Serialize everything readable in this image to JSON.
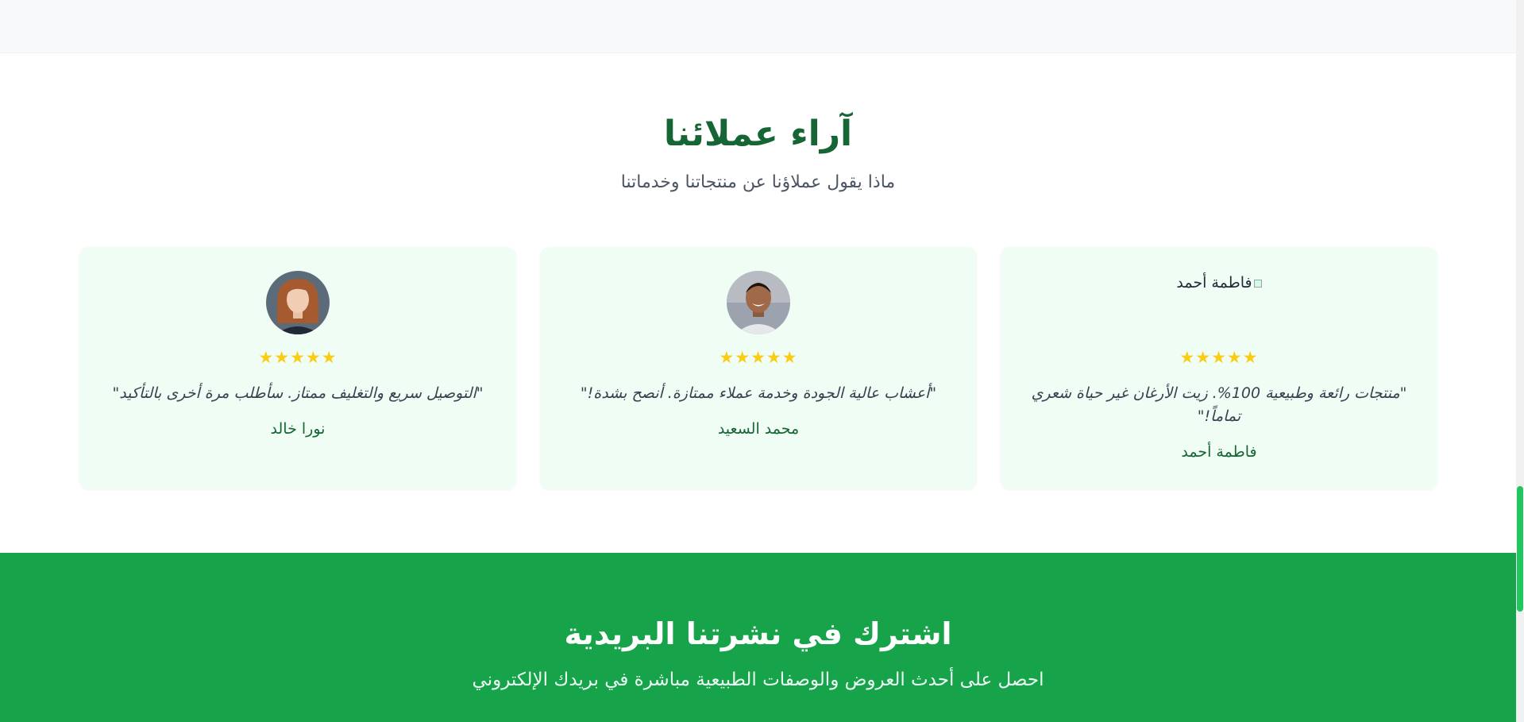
{
  "testimonials": {
    "title": "آراء عملائنا",
    "subtitle": "ماذا يقول عملاؤنا عن منتجاتنا وخدماتنا",
    "stars": "★★★★★",
    "cards": [
      {
        "broken_image_alt": "فاطمة أحمد",
        "quote": "\"منتجات رائعة وطبيعية 100%. زيت الأرغان غير حياة شعري تماماً!\"",
        "author": "فاطمة أحمد",
        "rating": 5
      },
      {
        "quote": "\"أعشاب عالية الجودة وخدمة عملاء ممتازة. أنصح بشدة!\"",
        "author": "محمد السعيد",
        "rating": 5
      },
      {
        "quote": "\"التوصيل سريع والتغليف ممتاز. سأطلب مرة أخرى بالتأكيد\"",
        "author": "نورا خالد",
        "rating": 5
      }
    ]
  },
  "newsletter": {
    "title": "اشترك في نشرتنا البريدية",
    "subtitle": "احصل على أحدث العروض والوصفات الطبيعية مباشرة في بريدك الإلكتروني"
  },
  "colors": {
    "primary": "#16a34a",
    "heading": "#166534",
    "card_bg": "#f0fdf4",
    "star": "#facc15"
  }
}
